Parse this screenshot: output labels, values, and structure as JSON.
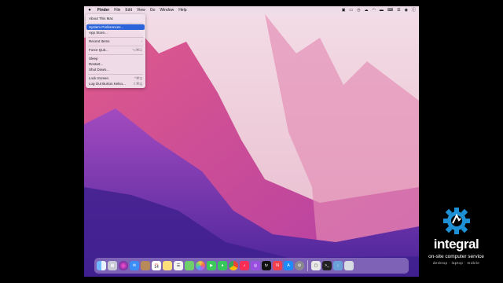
{
  "menubar": {
    "app_name": "Finder",
    "items": [
      "File",
      "Edit",
      "View",
      "Go",
      "Window",
      "Help"
    ]
  },
  "apple_menu": {
    "rows": [
      {
        "label": "About This Mac",
        "shortcut": ""
      },
      {
        "label": "System Preferences...",
        "shortcut": "",
        "selected": true
      },
      {
        "label": "App Store...",
        "shortcut": ""
      },
      {
        "label": "Recent Items",
        "shortcut": "›"
      },
      {
        "label": "Force Quit...",
        "shortcut": "⌥⌘⎋"
      },
      {
        "label": "Sleep",
        "shortcut": ""
      },
      {
        "label": "Restart...",
        "shortcut": ""
      },
      {
        "label": "Shut Down...",
        "shortcut": ""
      },
      {
        "label": "Lock Screen",
        "shortcut": "^⌘Q"
      },
      {
        "label": "Log Out Burton Kelso...",
        "shortcut": "⇧⌘Q"
      }
    ]
  },
  "dock": {
    "calendar_day": "14",
    "calendar_month": "JUL",
    "apps": [
      "finder",
      "launchpad",
      "siri",
      "mail",
      "contacts",
      "calendar",
      "notes",
      "reminders",
      "maps",
      "photos",
      "facetime",
      "messages",
      "chrome",
      "music",
      "podcasts",
      "appletv",
      "news",
      "appstore",
      "system-preferences",
      "screenshot",
      "terminal",
      "downloads",
      "trash"
    ]
  },
  "brand": {
    "name": "integral",
    "tagline": "on-site computer service",
    "subtag": "desktop · laptop · mobile",
    "accent": "#1e90d6"
  }
}
